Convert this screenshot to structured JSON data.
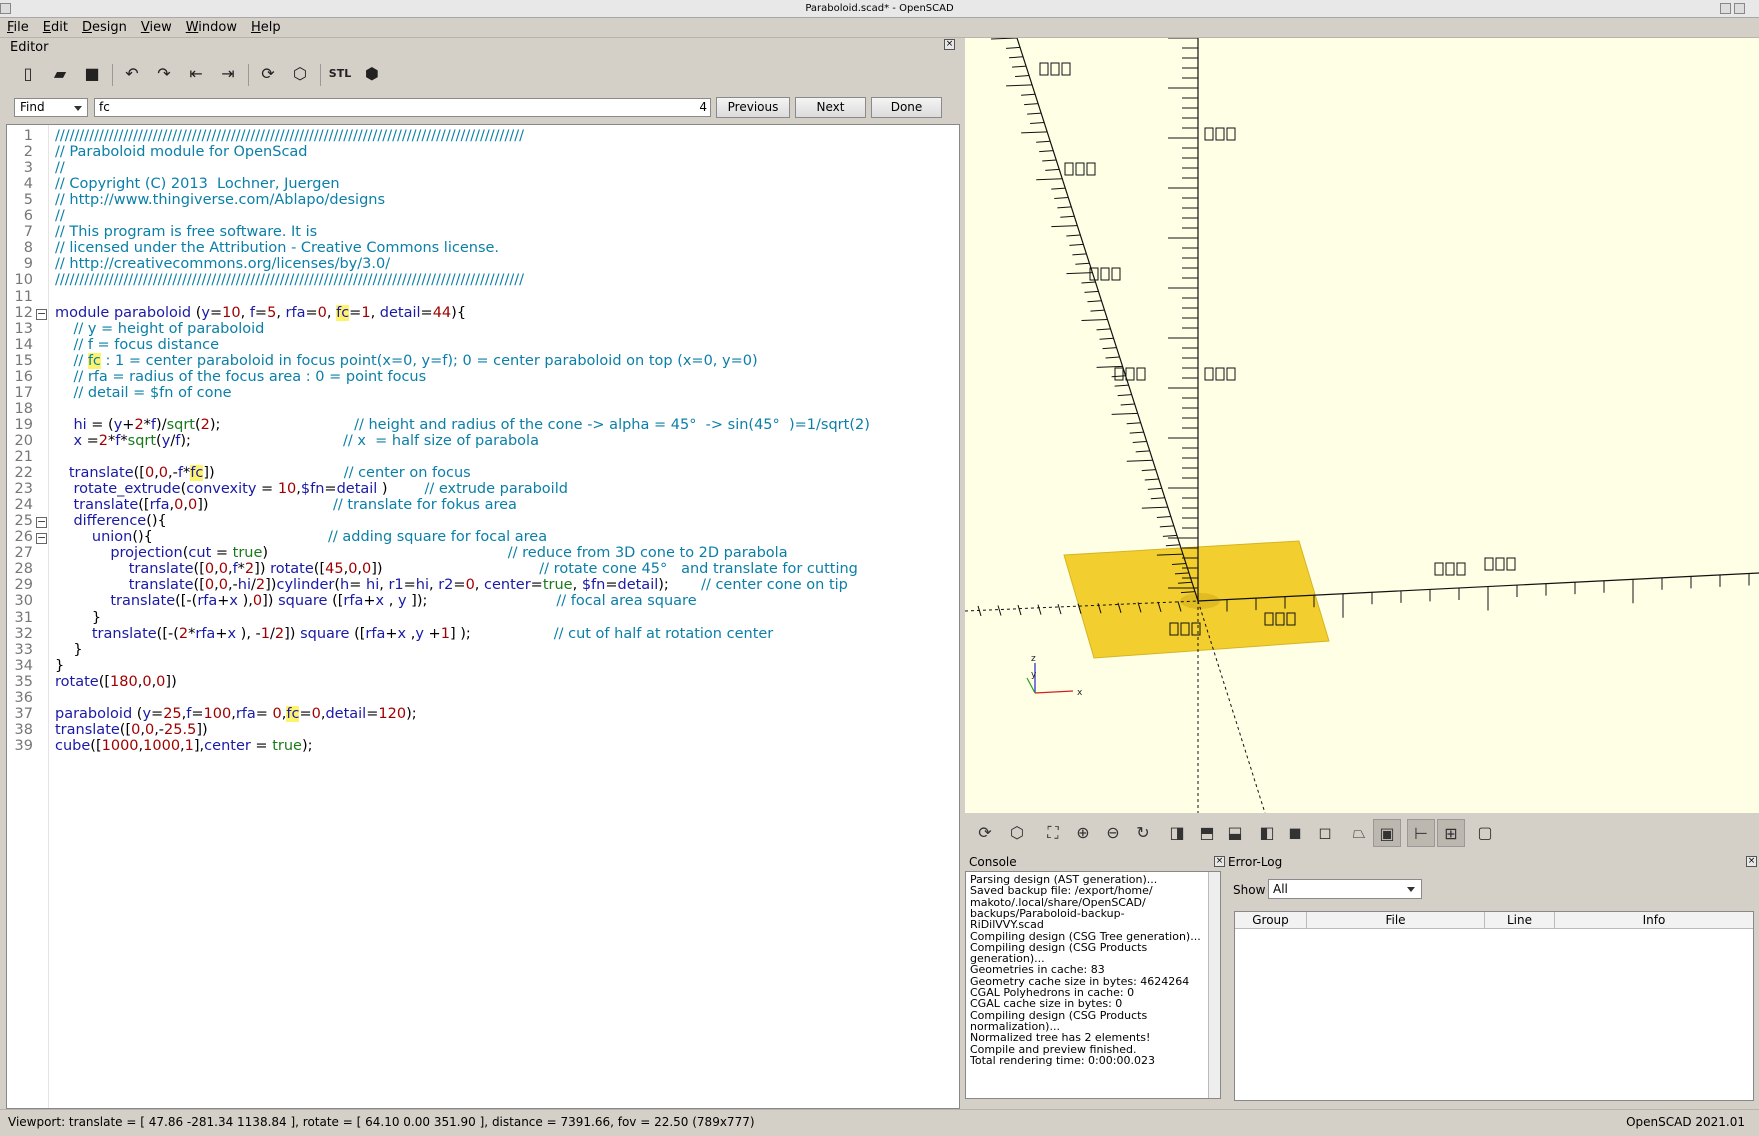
{
  "window": {
    "title": "Paraboloid.scad* - OpenSCAD"
  },
  "menu": [
    "File",
    "Edit",
    "Design",
    "View",
    "Window",
    "Help"
  ],
  "editor": {
    "title": "Editor",
    "toolbar_icons": [
      "new-file-icon",
      "open-file-icon",
      "save-icon",
      "undo-icon",
      "redo-icon",
      "unindent-icon",
      "indent-icon",
      "preview-icon",
      "render-icon",
      "export-stl-icon",
      "send-to-print-icon"
    ],
    "stl_label": "STL",
    "find": {
      "mode": "Find",
      "value": "fc",
      "count": "4",
      "previous_label": "Previous",
      "next_label": "Next",
      "done_label": "Done"
    },
    "lines": [
      "////////////////////////////////////////////////////////////////////////////////////////////////",
      "// Paraboloid module for OpenScad",
      "//",
      "// Copyright (C) 2013  Lochner, Juergen",
      "// http://www.thingiverse.com/Ablapo/designs",
      "//",
      "// This program is free software. It is",
      "// licensed under the Attribution - Creative Commons license.",
      "// http://creativecommons.org/licenses/by/3.0/",
      "////////////////////////////////////////////////////////////////////////////////////////////////",
      "",
      "module paraboloid (y=10, f=5, rfa=0, fc=1, detail=44){",
      "    // y = height of paraboloid",
      "    // f = focus distance",
      "    // fc : 1 = center paraboloid in focus point(x=0, y=f); 0 = center paraboloid on top (x=0, y=0)",
      "    // rfa = radius of the focus area : 0 = point focus",
      "    // detail = $fn of cone",
      "",
      "    hi = (y+2*f)/sqrt(2);                             // height and radius of the cone -> alpha = 45°  -> sin(45°  )=1/sqrt(2)",
      "    x =2*f*sqrt(y/f);                                 // x  = half size of parabola",
      "",
      "   translate([0,0,-f*fc])                            // center on focus",
      "    rotate_extrude(convexity = 10,$fn=detail )        // extrude paraboild",
      "    translate([rfa,0,0])                           // translate for fokus area",
      "    difference(){",
      "        union(){                                      // adding square for focal area",
      "            projection(cut = true)                                                    // reduce from 3D cone to 2D parabola",
      "                translate([0,0,f*2]) rotate([45,0,0])                                  // rotate cone 45°   and translate for cutting",
      "                translate([0,0,-hi/2])cylinder(h= hi, r1=hi, r2=0, center=true, $fn=detail);       // center cone on tip",
      "            translate([-(rfa+x ),0]) square ([rfa+x , y ]);                            // focal area square",
      "        }",
      "        translate([-(2*rfa+x ), -1/2]) square ([rfa+x ,y +1] );                  // cut of half at rotation center",
      "    }",
      "}",
      "rotate([180,0,0])",
      "",
      "paraboloid (y=25,f=100,rfa= 0,fc=0,detail=120);",
      "translate([0,0,-25.5])",
      "cube([1000,1000,1],center = true);"
    ],
    "fold_lines": [
      12,
      25,
      26
    ]
  },
  "view_toolbar_icons": [
    "preview-icon",
    "render-icon",
    "view-all-icon",
    "zoom-in-icon",
    "zoom-out-icon",
    "reset-view-icon",
    "view-right-icon",
    "view-top-icon",
    "view-bottom-icon",
    "view-left-icon",
    "view-front-icon",
    "view-back-icon",
    "perspective-icon",
    "orthogonal-icon",
    "show-axes-icon",
    "show-scale-markers-icon",
    "show-edges-icon"
  ],
  "console": {
    "title": "Console",
    "lines": [
      "Parsing design (AST generation)...",
      "Saved backup file: /export/home/",
      "makoto/.local/share/OpenSCAD/",
      "backups/Paraboloid-backup-",
      "RiDilVVY.scad",
      "Compiling design (CSG Tree generation)...",
      "Compiling design (CSG Products",
      "generation)...",
      "Geometries in cache: 83",
      "Geometry cache size in bytes: 4624264",
      "CGAL Polyhedrons in cache: 0",
      "CGAL cache size in bytes: 0",
      "Compiling design (CSG Products",
      "normalization)...",
      "Normalized tree has 2 elements!",
      "Compile and preview finished.",
      "Total rendering time: 0:00:00.023"
    ]
  },
  "errorlog": {
    "title": "Error-Log",
    "show_label": "Show",
    "show_value": "All",
    "columns": [
      "Group",
      "File",
      "Line",
      "Info"
    ]
  },
  "status": {
    "viewport": "Viewport: translate = [ 47.86 -281.34 1138.84 ], rotate = [ 64.10 0.00 351.90 ], distance = 7391.66, fov = 22.50 (789x777)",
    "version": "OpenSCAD 2021.01"
  },
  "viewport_3d": {
    "background": "#ffffe6",
    "plane_color": "#f2cf2f",
    "axis_color": "#111111",
    "x_axis_color": "#d02020",
    "y_axis_color": "#20a020",
    "z_axis_color": "#2020d0",
    "axis_labels": [
      "x",
      "y",
      "z"
    ]
  }
}
